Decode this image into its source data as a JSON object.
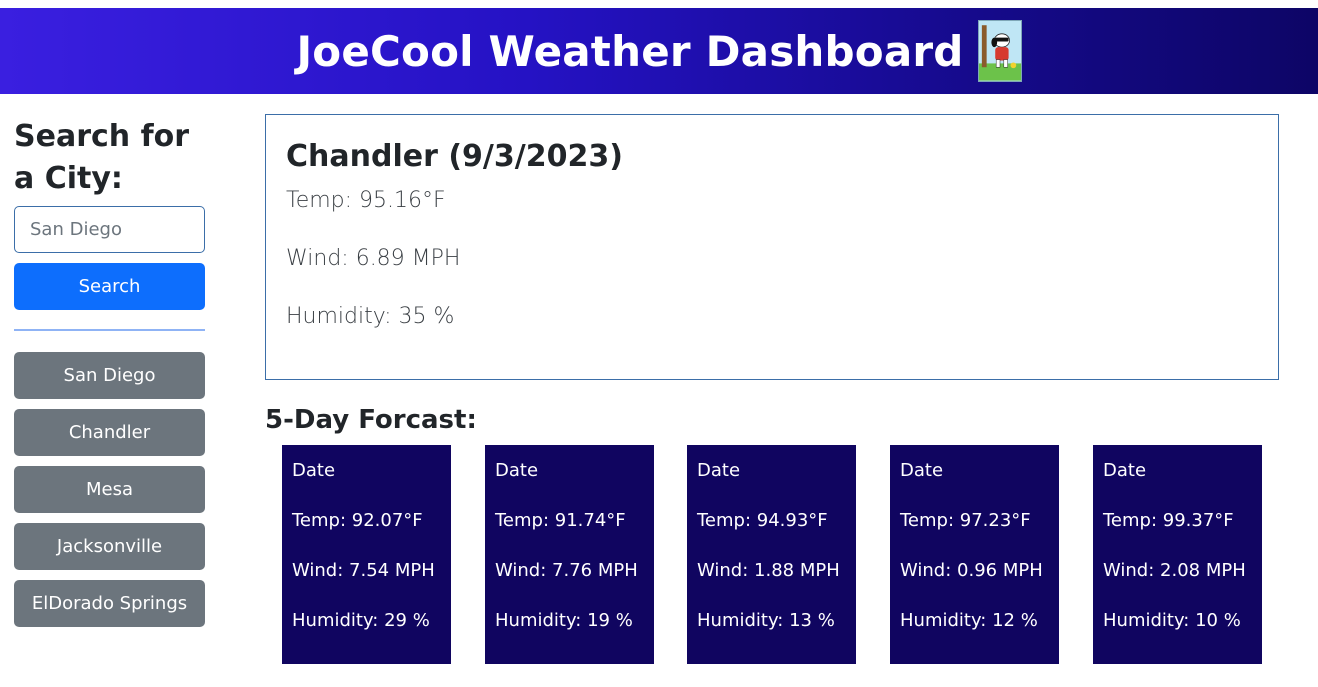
{
  "header": {
    "title": "JoeCool Weather Dashboard",
    "logo_icon": "snoopy-joecool-icon"
  },
  "sidebar": {
    "heading": "Search for a City:",
    "search_input": {
      "value": "",
      "placeholder": "San Diego"
    },
    "search_button": "Search",
    "history": [
      {
        "label": "San Diego"
      },
      {
        "label": "Chandler"
      },
      {
        "label": "Mesa"
      },
      {
        "label": "Jacksonville"
      },
      {
        "label": "ElDorado Springs"
      }
    ]
  },
  "current": {
    "title": "Chandler (9/3/2023)",
    "temp": "Temp: 95.16°F",
    "wind": "Wind: 6.89 MPH",
    "humidity": "Humidity: 35 %"
  },
  "forecast": {
    "heading": "5-Day Forcast:",
    "days": [
      {
        "date": "Date",
        "temp": "Temp: 92.07°F",
        "wind": "Wind: 7.54 MPH",
        "humidity": "Humidity: 29 %"
      },
      {
        "date": "Date",
        "temp": "Temp: 91.74°F",
        "wind": "Wind: 7.76 MPH",
        "humidity": "Humidity: 19 %"
      },
      {
        "date": "Date",
        "temp": "Temp: 94.93°F",
        "wind": "Wind: 1.88 MPH",
        "humidity": "Humidity: 13 %"
      },
      {
        "date": "Date",
        "temp": "Temp: 97.23°F",
        "wind": "Wind: 0.96 MPH",
        "humidity": "Humidity: 12 %"
      },
      {
        "date": "Date",
        "temp": "Temp: 99.37°F",
        "wind": "Wind: 2.08 MPH",
        "humidity": "Humidity: 10 %"
      }
    ]
  },
  "colors": {
    "header_gradient_start": "#3a1fe0",
    "header_gradient_end": "#0d0566",
    "search_button": "#0d6efd",
    "history_button": "#6c757d",
    "forecast_card": "#100560",
    "card_border": "#3b6ea8"
  }
}
